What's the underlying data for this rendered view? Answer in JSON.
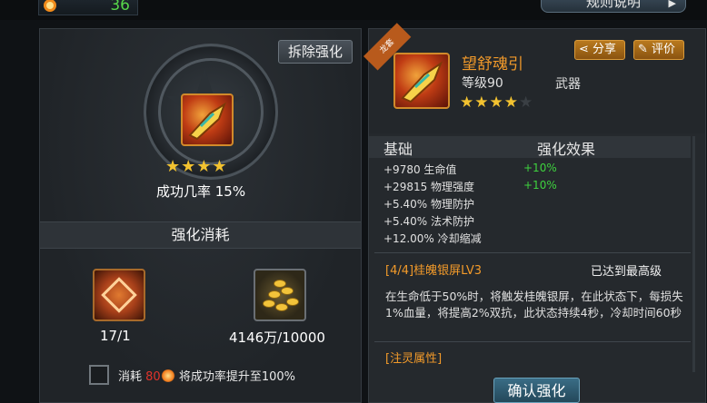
{
  "top": {
    "resource_count": "36",
    "rules_label": "规则说明"
  },
  "left": {
    "remove_label": "拆除强化",
    "stars": "★★★★",
    "success_rate": "成功几率 15%",
    "cost_title": "强化消耗",
    "material1_count": "17/1",
    "material2_count": "4146万/10000",
    "consume_prefix": "消耗",
    "consume_amount": "80",
    "consume_suffix": "将成功率提升至100%"
  },
  "right": {
    "ribbon": "龙套",
    "share_label": "分享",
    "review_label": "评价",
    "item_name": "望舒魂引",
    "item_level": "等级90",
    "item_type": "武器",
    "stars_on": "★★★★",
    "stars_off": "★",
    "stats_base_label": "基础",
    "stats_effect_label": "强化效果",
    "stats": [
      {
        "text": "+9780 生命值",
        "bonus": "+10%"
      },
      {
        "text": "+29815 物理强度",
        "bonus": "+10%"
      },
      {
        "text": "+5.40% 物理防护",
        "bonus": ""
      },
      {
        "text": "+5.40% 法术防护",
        "bonus": ""
      },
      {
        "text": "+12.00% 冷却缩减",
        "bonus": ""
      }
    ],
    "skill_name": "[4/4]桂魄银屏LV3",
    "skill_status": "已达到最高级",
    "skill_desc": "在生命低于50%时，将触发桂魄银屏，在此状态下，每损失1%血量，将提高2%双抗，此状态持续4秒，冷却时间60秒",
    "spirit_label": "[注灵属性]",
    "confirm_label": "确认强化"
  },
  "colors": {
    "accent_orange": "#f29a2a",
    "bonus_green": "#3ed23e",
    "star_gold": "#f2c230"
  }
}
